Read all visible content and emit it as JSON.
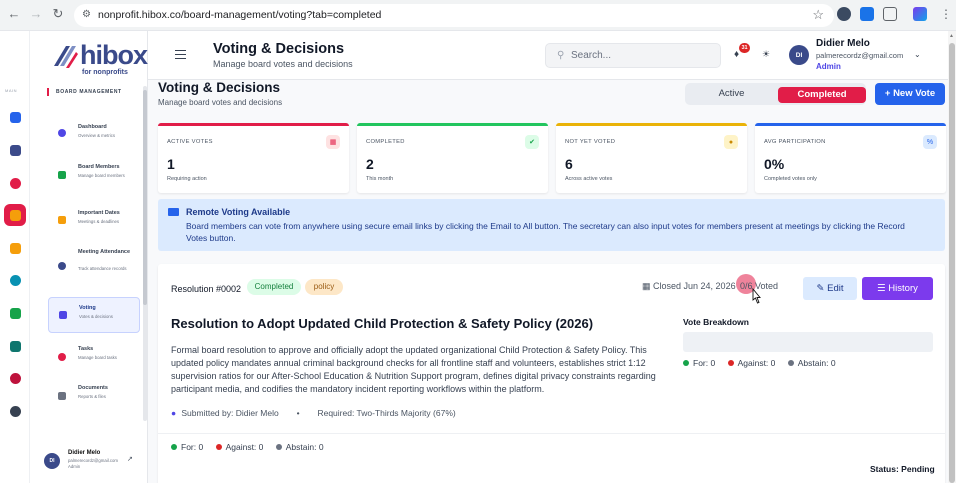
{
  "browser": {
    "url": "nonprofit.hibox.co/board-management/voting?tab=completed"
  },
  "brand": {
    "name": "hibox",
    "tagline": "for nonprofits",
    "primary_color": "#3a4a8a",
    "accent_color": "#e11d48"
  },
  "iconbar": {
    "label": "MAIN"
  },
  "sidebar": {
    "section_title": "BOARD MANAGEMENT",
    "items": [
      {
        "label": "Dashboard",
        "desc": "Overview & metrics",
        "icon": "dashboard-icon"
      },
      {
        "label": "Board Members",
        "desc": "Manage board members",
        "icon": "users-icon"
      },
      {
        "label": "Important Dates",
        "desc": "Meetings & deadlines",
        "icon": "calendar-icon"
      },
      {
        "label": "Meeting Attendance",
        "desc": "Track attendance records",
        "icon": "attendance-icon"
      },
      {
        "label": "Voting",
        "desc": "Votes & decisions",
        "icon": "ballot-icon"
      },
      {
        "label": "Tasks",
        "desc": "Manage board tasks",
        "icon": "tasks-icon"
      },
      {
        "label": "Documents",
        "desc": "Reports & files",
        "icon": "documents-icon"
      }
    ],
    "user": {
      "initials": "DI",
      "name": "Didier Melo",
      "email": "palmerecordz@gmail.com",
      "role": "Admin"
    }
  },
  "header": {
    "title": "Voting & Decisions",
    "subtitle": "Manage board votes and decisions",
    "search_placeholder": "Search...",
    "notification_count": "31",
    "user": {
      "initials": "DI",
      "name": "Didier Melo",
      "email": "palmerecordz@gmail.com",
      "role": "Admin"
    }
  },
  "page": {
    "title": "Voting & Decisions",
    "subtitle": "Manage board votes and decisions",
    "tabs": {
      "active": "Active",
      "completed": "Completed"
    },
    "new_vote_label": "New Vote"
  },
  "stats": [
    {
      "label": "ACTIVE VOTES",
      "value": "1",
      "note": "Requiring action",
      "color": "#e11d48"
    },
    {
      "label": "COMPLETED",
      "value": "2",
      "note": "This month",
      "color": "#22c55e"
    },
    {
      "label": "NOT YET VOTED",
      "value": "6",
      "note": "Across active votes",
      "color": "#eab308"
    },
    {
      "label": "AVG PARTICIPATION",
      "value": "0%",
      "note": "Completed votes only",
      "color": "#2563eb"
    }
  ],
  "info": {
    "title": "Remote Voting Available",
    "body": "Board members can vote from anywhere using secure email links by clicking the Email to All button. The secretary can also input votes for members present at meetings by clicking the Record Votes button."
  },
  "resolution": {
    "id": "Resolution #0002",
    "status_badge": "Completed",
    "category_badge": "policy",
    "closed": "Closed Jun 24, 2026",
    "voted": "0/6 Voted",
    "edit_label": "Edit",
    "history_label": "History",
    "title": "Resolution to Adopt Updated Child Protection & Safety Policy (2026)",
    "description": "Formal board resolution to approve and officially adopt the updated organizational Child Protection & Safety Policy. This updated policy mandates annual criminal background checks for all frontline staff and volunteers, establishes strict 1:12 supervision ratios for our After-School Education & Nutrition Support program, defines digital privacy constraints regarding participant media, and codifies the mandatory incident reporting workflows within the platform.",
    "submitted_by": "Submitted by: Didier Melo",
    "required": "Required: Two-Thirds Majority (67%)",
    "breakdown_title": "Vote Breakdown",
    "counts": {
      "for": "For: 0",
      "against": "Against: 0",
      "abstain": "Abstain: 0"
    },
    "footer_counts": {
      "for": "For: 0",
      "against": "Against: 0",
      "abstain": "Abstain: 0"
    },
    "status": "Status: Pending"
  }
}
